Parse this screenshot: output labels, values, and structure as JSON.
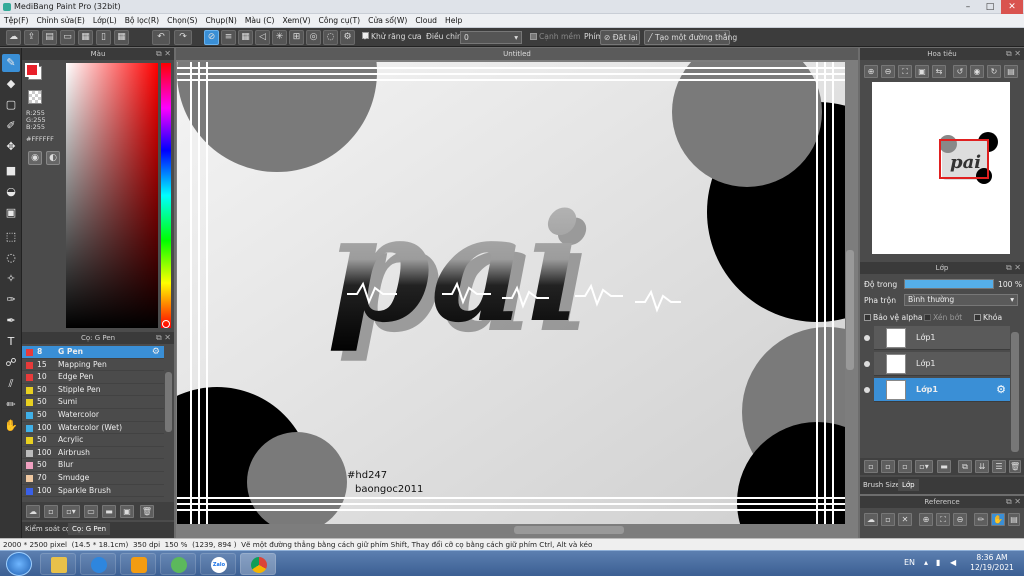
{
  "window": {
    "title": "MediBang Paint Pro (32bit)",
    "minimize": "–",
    "maximize": "□",
    "close": "✕"
  },
  "menu": [
    "Tệp(F)",
    "Chỉnh sửa(E)",
    "Lớp(L)",
    "Bộ lọc(R)",
    "Chọn(S)",
    "Chụp(N)",
    "Màu (C)",
    "Xem(V)",
    "Công cụ(T)",
    "Cửa sổ(W)",
    "Cloud",
    "Help"
  ],
  "toolbar": {
    "antialias_label": "Khử răng cưa",
    "adjust_label": "Điều chỉnh",
    "adjust_value": "0",
    "edge_label": "Cạnh mềm",
    "key_label": "Phím",
    "reset_label": "Đặt lại",
    "straight_line_label": "Tạo một đường thẳng"
  },
  "color_panel": {
    "title": "Màu",
    "r": "R:255",
    "g": "G:255",
    "b": "B:255",
    "hex": "#FFFFFF",
    "primary_color": "#e8202a",
    "secondary_color": "#ffffff"
  },
  "brush_panel": {
    "title": "Cọ: G Pen",
    "items": [
      {
        "size": "8",
        "name": "G Pen",
        "color": "#e83a3a"
      },
      {
        "size": "15",
        "name": "Mapping Pen",
        "color": "#e83a3a"
      },
      {
        "size": "10",
        "name": "Edge Pen",
        "color": "#e83a3a"
      },
      {
        "size": "50",
        "name": "Stipple Pen",
        "color": "#e8d020"
      },
      {
        "size": "50",
        "name": "Sumi",
        "color": "#e8d020"
      },
      {
        "size": "50",
        "name": "Watercolor",
        "color": "#3fb0e8"
      },
      {
        "size": "100",
        "name": "Watercolor (Wet)",
        "color": "#3fb0e8"
      },
      {
        "size": "50",
        "name": "Acrylic",
        "color": "#e8d020"
      },
      {
        "size": "100",
        "name": "Airbrush",
        "color": "#bbbbbb"
      },
      {
        "size": "50",
        "name": "Blur",
        "color": "#f0a0c0"
      },
      {
        "size": "70",
        "name": "Smudge",
        "color": "#f0c8a0"
      },
      {
        "size": "100",
        "name": "Sparkle Brush",
        "color": "#3a60e8"
      }
    ],
    "tab_brush_control": "Kiểm soát cọ",
    "tab_current": "Cọ: G Pen"
  },
  "canvas": {
    "title": "Untitled",
    "artwork_text": "pai",
    "sig_line1": "#hd247",
    "sig_line2": "baongoc2011"
  },
  "navigator": {
    "title": "Hoa tiêu"
  },
  "layer_panel": {
    "title": "Lớp",
    "opacity_label": "Độ trong",
    "opacity_value": "100 %",
    "opacity_fraction": 1.0,
    "blend_label": "Pha trộn",
    "blend_value": "Bình thường",
    "protect_alpha": "Bảo vệ alpha",
    "clip": "Xén bớt",
    "lock": "Khóa",
    "layers": [
      {
        "name": "Lớp1",
        "selected": false
      },
      {
        "name": "Lớp1",
        "selected": false
      },
      {
        "name": "Lớp1",
        "selected": true
      }
    ],
    "tab_brush_size": "Brush Size",
    "tab_layer": "Lớp"
  },
  "reference_panel": {
    "title": "Reference"
  },
  "status": {
    "size": "2000 * 2500 pixel",
    "physical": "(14.5 * 18.1cm)",
    "dpi": "350 dpi",
    "zoom": "150 %",
    "coords": "(1239, 894 )",
    "hint": "Vẽ một đường thẳng bằng cách giữ phím Shift, Thay đổi cỡ cọ bằng cách giữ phím Ctrl, Alt và kéo"
  },
  "taskbar": {
    "lang": "EN",
    "time": "8:36 AM",
    "date": "12/19/2021",
    "zalo": "Zalo"
  }
}
